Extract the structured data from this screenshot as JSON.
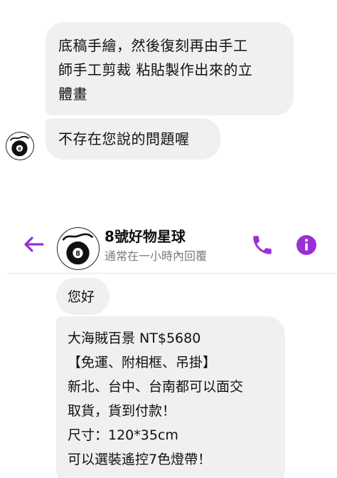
{
  "earlier_messages": [
    {
      "lines": [
        "底稿手繪，然後復刻再由手工",
        "師手工剪裁 粘貼製作出來的立",
        "體畫"
      ]
    },
    {
      "lines": [
        "不存在您說的問題喔"
      ]
    }
  ],
  "header": {
    "contact_name": "8號好物星球",
    "status": "通常在一小時內回覆",
    "back_icon": "arrow-left-icon",
    "call_icon": "phone-icon",
    "info_icon": "info-icon",
    "accent_color": "#9b2fd6"
  },
  "messages": [
    {
      "lines": [
        "您好"
      ]
    },
    {
      "lines": [
        "大海賊百景 NT$5680",
        "【免運、附相框、吊掛】",
        "新北、台中、台南都可以面交",
        "取貨，貨到付款！",
        "尺寸：120*35cm",
        "可以選裝遙控7色燈帶！"
      ]
    }
  ]
}
